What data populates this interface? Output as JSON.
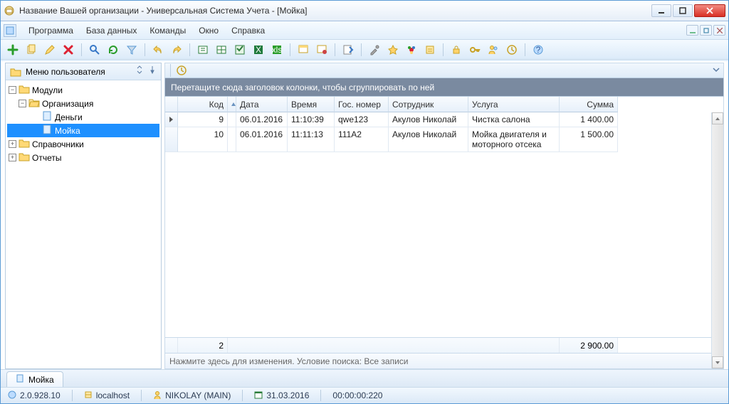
{
  "window": {
    "title": "Название Вашей организации - Универсальная Система Учета - [Мойка]"
  },
  "menu": {
    "items": [
      "Программа",
      "База данных",
      "Команды",
      "Окно",
      "Справка"
    ]
  },
  "sidebar": {
    "title": "Меню пользователя",
    "tree": {
      "root": "Модули",
      "org": "Организация",
      "money": "Деньги",
      "wash": "Мойка",
      "dir": "Справочники",
      "reports": "Отчеты"
    }
  },
  "grid": {
    "group_hint": "Перетащите сюда заголовок колонки, чтобы сгруппировать по ней",
    "columns": {
      "code": "Код",
      "date": "Дата",
      "time": "Время",
      "plate": "Гос. номер",
      "employee": "Сотрудник",
      "service": "Услуга",
      "sum": "Сумма"
    },
    "rows": [
      {
        "code": "9",
        "date": "06.01.2016",
        "time": "11:10:39",
        "plate": "qwe123",
        "employee": "Акулов Николай",
        "service": "Чистка салона",
        "sum": "1 400.00"
      },
      {
        "code": "10",
        "date": "06.01.2016",
        "time": "11:11:13",
        "plate": "111A2",
        "employee": "Акулов Николай",
        "service": "Мойка двигателя и моторного отсека",
        "sum": "1 500.00"
      }
    ],
    "summary": {
      "count": "2",
      "total": "2 900.00"
    },
    "filter_text": "Нажмите здесь для изменения. Условие поиска: Все записи"
  },
  "tabs": {
    "active": "Мойка"
  },
  "status": {
    "version": "2.0.928.10",
    "host": "localhost",
    "user": "NIKOLAY (MAIN)",
    "date": "31.03.2016",
    "elapsed": "00:00:00:220"
  }
}
